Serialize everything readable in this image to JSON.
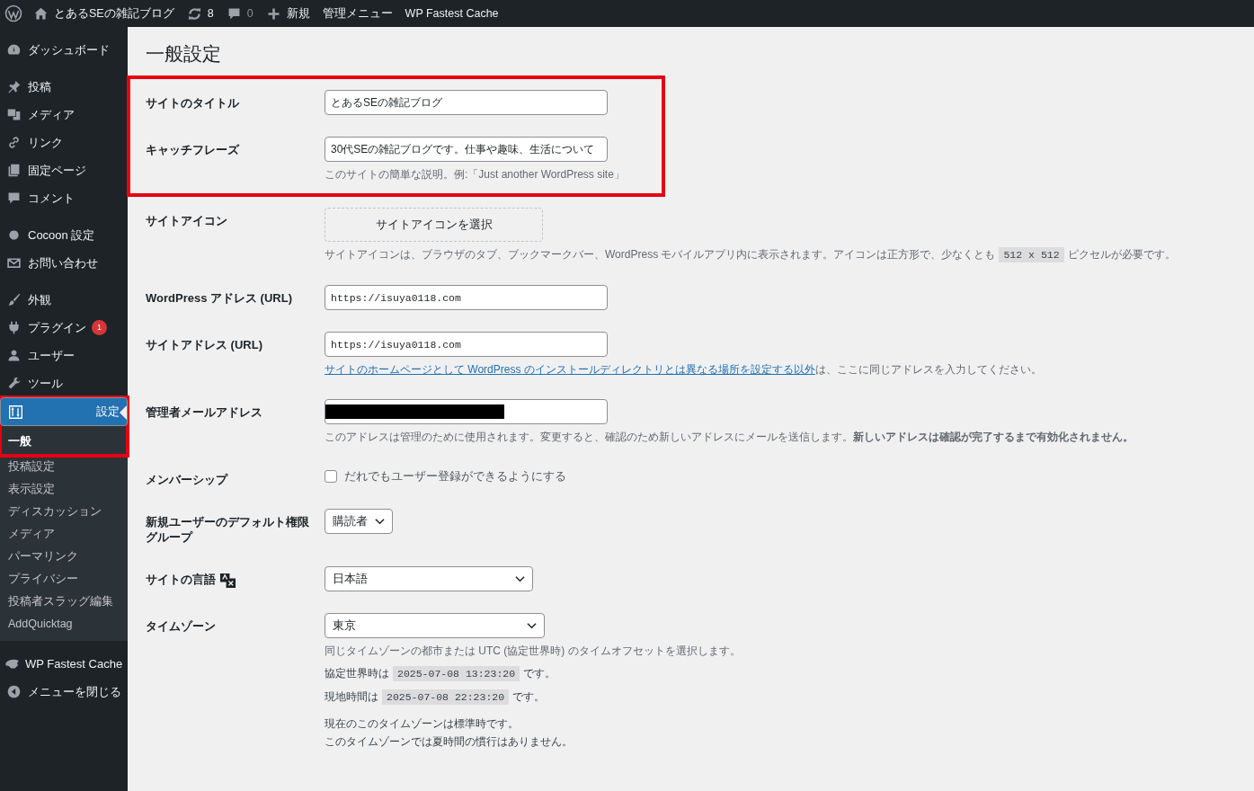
{
  "admin_bar": {
    "site_name": "とあるSEの雑記ブログ",
    "updates": "8",
    "comments": "0",
    "new": "新規",
    "links": [
      "管理メニュー",
      "WP Fastest Cache"
    ]
  },
  "sidebar": {
    "groups": [
      [
        {
          "label": "ダッシュボード",
          "selected": false
        }
      ],
      [
        {
          "label": "投稿",
          "selected": false
        },
        {
          "label": "メディア",
          "selected": false
        },
        {
          "label": "リンク",
          "selected": false
        },
        {
          "label": "固定ページ",
          "selected": false
        },
        {
          "label": "コメント",
          "selected": false
        }
      ],
      [
        {
          "label": "Cocoon 設定",
          "selected": false
        },
        {
          "label": "お問い合わせ",
          "selected": false
        }
      ],
      [
        {
          "label": "外観",
          "selected": false
        },
        {
          "label": "プラグイン",
          "selected": false,
          "badge": "1"
        },
        {
          "label": "ユーザー",
          "selected": false
        },
        {
          "label": "ツール",
          "selected": false
        },
        {
          "label": "設定",
          "selected": true,
          "highlighted": true,
          "submenu": [
            {
              "label": "一般",
              "selected": true
            },
            {
              "label": "投稿設定",
              "selected": false
            },
            {
              "label": "表示設定",
              "selected": false
            },
            {
              "label": "ディスカッション",
              "selected": false
            },
            {
              "label": "メディア",
              "selected": false
            },
            {
              "label": "パーマリンク",
              "selected": false
            },
            {
              "label": "プライバシー",
              "selected": false
            },
            {
              "label": "投稿者スラッグ編集",
              "selected": false
            },
            {
              "label": "AddQuicktag",
              "selected": false
            }
          ]
        }
      ],
      [
        {
          "label": "WP Fastest Cache",
          "selected": false
        },
        {
          "label": "メニューを閉じる",
          "selected": false
        }
      ]
    ]
  },
  "page_title": "一般設定",
  "sections": [
    {
      "highlighted": true,
      "rows": [
        {
          "kind": "text",
          "label": "サイトのタイトル",
          "value": "とあるSEの雑記ブログ"
        },
        {
          "kind": "text",
          "label": "キャッチフレーズ",
          "value": "30代SEの雑記ブログです。仕事や趣味、生活について",
          "description": [
            {
              "kind": "text",
              "text": "このサイトの簡単な説明。例:「Just another WordPress site」"
            }
          ]
        }
      ]
    },
    {
      "highlighted": false,
      "rows": [
        {
          "kind": "icon_button",
          "label": "サイトアイコン",
          "button": "サイトアイコンを選択",
          "description": [
            {
              "kind": "text",
              "text": "サイトアイコンは、ブラウザのタブ、ブックマークバー、WordPress モバイルアプリ内に表示されます。アイコンは正方形で、少なくとも"
            },
            {
              "kind": "code",
              "text": "512 x 512"
            },
            {
              "kind": "text",
              "text": "ピクセルが必要です。"
            }
          ]
        },
        {
          "kind": "url",
          "label": "WordPress アドレス (URL)",
          "value": "https://isuya0118.com"
        },
        {
          "kind": "url",
          "label": "サイトアドレス (URL)",
          "value": "https://isuya0118.com",
          "description": [
            {
              "kind": "link",
              "text": "サイトのホームページとして WordPress のインストールディレクトリとは異なる場所を設定する以外"
            },
            {
              "kind": "text",
              "text": "は、ここに同じアドレスを入力してください。"
            }
          ]
        },
        {
          "kind": "email",
          "label": "管理者メールアドレス",
          "redacted": true,
          "description": [
            {
              "kind": "text",
              "text": "このアドレスは管理のために使用されます。変更すると、確認のため新しいアドレスにメールを送信します。**新しいアドレスは確認が完了するまで有効化されません。**"
            }
          ]
        },
        {
          "kind": "checkbox",
          "label": "メンバーシップ",
          "option": "だれでもユーザー登録ができるようにする",
          "checked": false
        },
        {
          "kind": "dropdown",
          "label": "新規ユーザーのデフォルト権限グループ",
          "value": "購読者"
        },
        {
          "kind": "language",
          "label": "サイトの言語",
          "value": "日本語"
        },
        {
          "kind": "timezone",
          "label": "タイムゾーン",
          "value": "東京",
          "description": [
            {
              "kind": "text",
              "text": "同じタイムゾーンの都市または UTC (協定世界時) のタイムオフセットを選択します。"
            }
          ],
          "times": [
            [
              {
                "kind": "text",
                "text": "協定世界時は"
              },
              {
                "kind": "code",
                "text": "2025-07-08 13:23:20"
              },
              {
                "kind": "text",
                "text": "です。"
              }
            ],
            [
              {
                "kind": "text",
                "text": "現地時間は"
              },
              {
                "kind": "code",
                "text": "2025-07-08 22:23:20"
              },
              {
                "kind": "text",
                "text": "です。"
              }
            ]
          ],
          "notes": [
            "現在のこのタイムゾーンは標準時です。",
            "このタイムゾーンでは夏時間の慣行はありません。"
          ]
        }
      ]
    }
  ]
}
